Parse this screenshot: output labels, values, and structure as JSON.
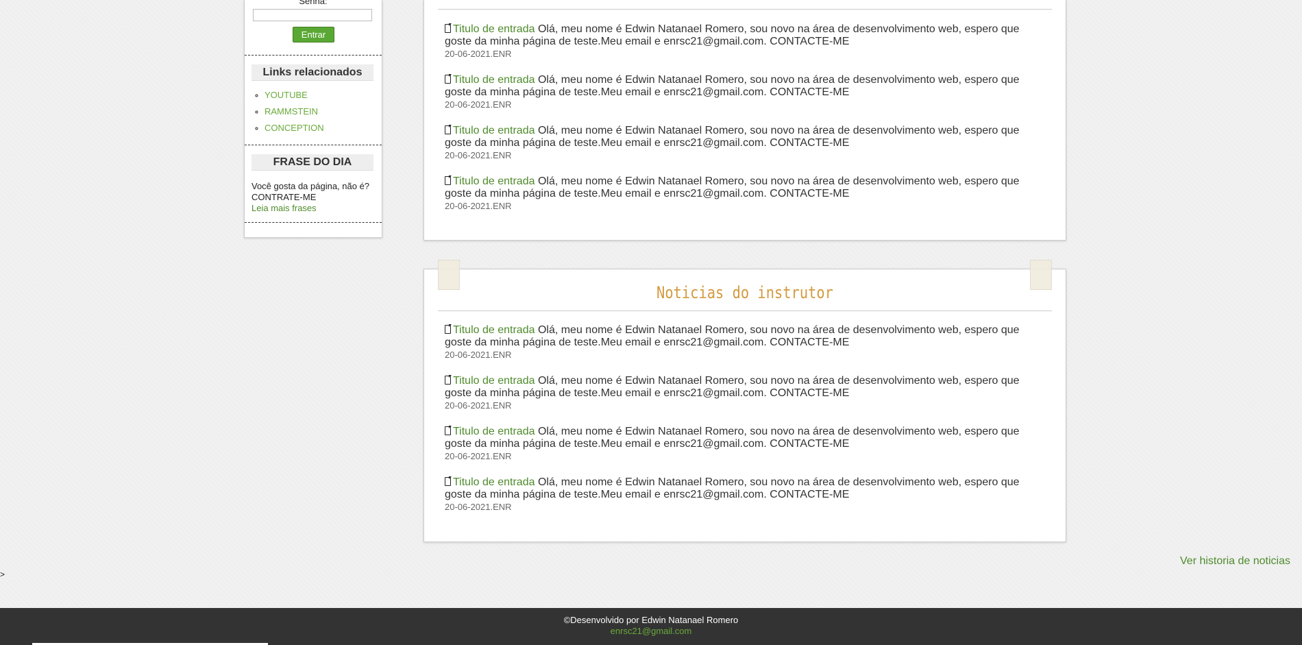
{
  "sidebar": {
    "senha_label": "Senha:",
    "entrar_label": "Entrar",
    "links_title": "Links relacionados",
    "links": [
      "YOUTUBE",
      "RAMMSTEIN",
      "CONCEPTION"
    ],
    "frase_title": "FRASE DO DIA",
    "frase_text": "Você gosta da página, não é? CONTRATE-ME",
    "frase_link": "Leia mais frases"
  },
  "news_panel_1": {
    "entries": [
      {
        "title": "Titulo de entrada",
        "text": "Olá, meu nome é Edwin Natanael Romero, sou novo na área de desenvolvimento web, espero que goste da minha página de teste.Meu email e enrsc21@gmail.com. CONTACTE-ME",
        "date": "20-06-2021.ENR"
      },
      {
        "title": "Titulo de entrada",
        "text": "Olá, meu nome é Edwin Natanael Romero, sou novo na área de desenvolvimento web, espero que goste da minha página de teste.Meu email e enrsc21@gmail.com. CONTACTE-ME",
        "date": "20-06-2021.ENR"
      },
      {
        "title": "Titulo de entrada",
        "text": "Olá, meu nome é Edwin Natanael Romero, sou novo na área de desenvolvimento web, espero que goste da minha página de teste.Meu email e enrsc21@gmail.com. CONTACTE-ME",
        "date": "20-06-2021.ENR"
      },
      {
        "title": "Titulo de entrada",
        "text": "Olá, meu nome é Edwin Natanael Romero, sou novo na área de desenvolvimento web, espero que goste da minha página de teste.Meu email e enrsc21@gmail.com. CONTACTE-ME",
        "date": "20-06-2021.ENR"
      }
    ]
  },
  "news_panel_2": {
    "title": "Noticias do instrutor",
    "entries": [
      {
        "title": "Titulo de entrada",
        "text": "Olá, meu nome é Edwin Natanael Romero, sou novo na área de desenvolvimento web, espero que goste da minha página de teste.Meu email e enrsc21@gmail.com. CONTACTE-ME",
        "date": "20-06-2021.ENR"
      },
      {
        "title": "Titulo de entrada",
        "text": "Olá, meu nome é Edwin Natanael Romero, sou novo na área de desenvolvimento web, espero que goste da minha página de teste.Meu email e enrsc21@gmail.com. CONTACTE-ME",
        "date": "20-06-2021.ENR"
      },
      {
        "title": "Titulo de entrada",
        "text": "Olá, meu nome é Edwin Natanael Romero, sou novo na área de desenvolvimento web, espero que goste da minha página de teste.Meu email e enrsc21@gmail.com. CONTACTE-ME",
        "date": "20-06-2021.ENR"
      },
      {
        "title": "Titulo de entrada",
        "text": "Olá, meu nome é Edwin Natanael Romero, sou novo na área de desenvolvimento web, espero que goste da minha página de teste.Meu email e enrsc21@gmail.com. CONTACTE-ME",
        "date": "20-06-2021.ENR"
      }
    ]
  },
  "ver_historia": "Ver historia de noticias",
  "stray_char": ">",
  "footer": {
    "credit": "©Desenvolvido por Edwin Natanael Romero",
    "email": "enrsc21@gmail.com"
  },
  "colors": {
    "accent_green": "#4e8b2c",
    "link_green": "#6aaa3a",
    "button_green": "#5aa834",
    "title_orange": "#d49a3f",
    "footer_bg": "#333333",
    "page_bg": "#f1f1f1"
  },
  "icons": {
    "entry_icon": "document-icon"
  }
}
